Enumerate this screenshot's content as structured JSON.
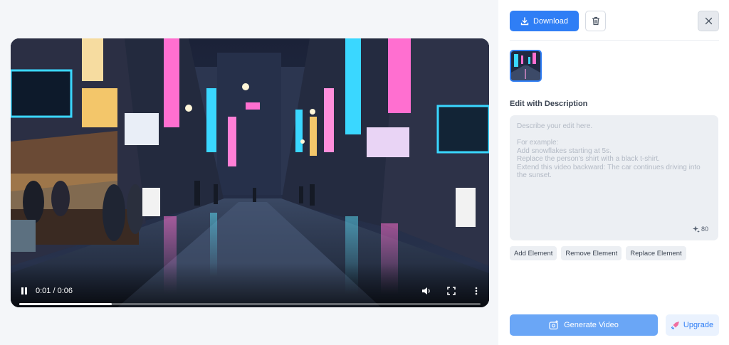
{
  "player": {
    "time_display": "0:01 / 0:06",
    "progress": 0.2,
    "controls": {
      "play_pause_icon": "pause-icon",
      "volume_icon": "volume-icon",
      "fullscreen_icon": "fullscreen-icon",
      "more_icon": "more-vertical-icon"
    }
  },
  "toolbar": {
    "download_label": "Download",
    "download_icon": "download-icon",
    "delete_icon": "trash-icon",
    "close_icon": "close-icon"
  },
  "edit": {
    "section_title": "Edit with Description",
    "placeholder": "Describe your edit here.\n\nFor example:\nAdd snowflakes starting at 5s.\nReplace the person's shirt with a black t-shirt.\nExtend this video backward: The car continues driving into the sunset.",
    "credits": "80",
    "credits_icon": "sparkle-icon"
  },
  "chips": [
    "Add Element",
    "Remove Element",
    "Replace Element"
  ],
  "actions": {
    "generate_label": "Generate Video",
    "generate_icon": "camera-plus-icon",
    "upgrade_label": "Upgrade",
    "upgrade_icon": "rocket-icon"
  },
  "colors": {
    "accent": "#2f7ef5",
    "generate_bg": "#6aa6f6",
    "upgrade_bg": "#eaf2fe"
  }
}
